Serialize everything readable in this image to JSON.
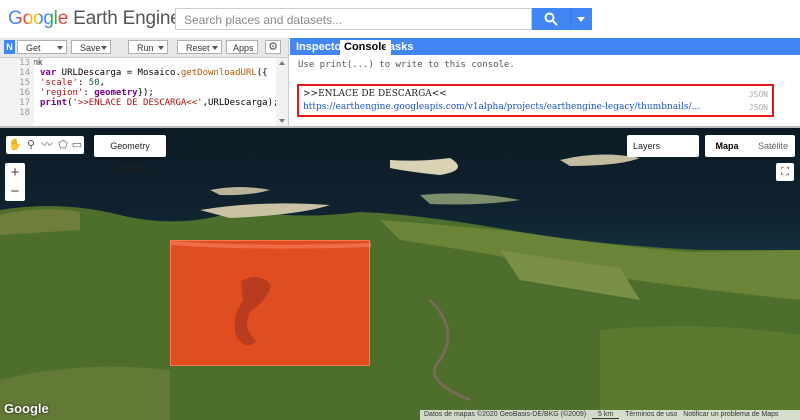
{
  "header": {
    "logo_google": "Google",
    "logo_product": "Earth Engine",
    "search_placeholder": "Search places and datasets..."
  },
  "editor": {
    "badge": "N",
    "buttons": {
      "get_link": "Get Link",
      "save": "Save",
      "run": "Run",
      "reset": "Reset",
      "apps": "Apps"
    },
    "line_numbers": [
      "13",
      "14",
      "15",
      "16",
      "17",
      "18"
    ],
    "code_lines": [
      {
        "parts": [
          {
            "t": "",
            "c": ""
          }
        ]
      },
      {
        "parts": [
          {
            "t": "var",
            "c": "kw"
          },
          {
            "t": " URLDescarga = Mosaico.",
            "c": ""
          },
          {
            "t": "getDownloadURL",
            "c": "fn"
          },
          {
            "t": "({",
            "c": ""
          }
        ]
      },
      {
        "parts": [
          {
            "t": "'scale'",
            "c": "str"
          },
          {
            "t": ": ",
            "c": ""
          },
          {
            "t": "50",
            "c": "num"
          },
          {
            "t": ",",
            "c": ""
          }
        ]
      },
      {
        "parts": [
          {
            "t": "'region'",
            "c": "str"
          },
          {
            "t": ": ",
            "c": ""
          },
          {
            "t": "geometry",
            "c": "kw"
          },
          {
            "t": "});",
            "c": ""
          }
        ]
      },
      {
        "parts": [
          {
            "t": "print",
            "c": "kw"
          },
          {
            "t": "(",
            "c": ""
          },
          {
            "t": "'>>ENLACE DE DESCARGA<<'",
            "c": "str"
          },
          {
            "t": ",URLDescarga);",
            "c": ""
          }
        ]
      },
      {
        "parts": [
          {
            "t": "",
            "c": ""
          }
        ]
      }
    ]
  },
  "console": {
    "tabs": {
      "inspector": "Inspector",
      "console": "Console",
      "tasks": "Tasks"
    },
    "hint": "Use print(...) to write to this console.",
    "output_label": ">>ENLACE DE DESCARGA<<",
    "output_link": "https://earthengine.googleapis.com/v1alpha/projects/earthengine-legacy/thumbnails/...",
    "json_tag": "JSON"
  },
  "map": {
    "geometry_imports": "Geometry Imports",
    "layers": "Layers",
    "map_type_map": "Mapa",
    "map_type_satellite": "Satélite",
    "google_logo": "Google",
    "attribution": "Datos de mapas ©2020 GeoBasis-DE/BKG (©2009)",
    "scale": "5 km",
    "terms": "Términos de uso",
    "report": "Notificar un problema de Maps",
    "region_color": "#ff4620"
  }
}
